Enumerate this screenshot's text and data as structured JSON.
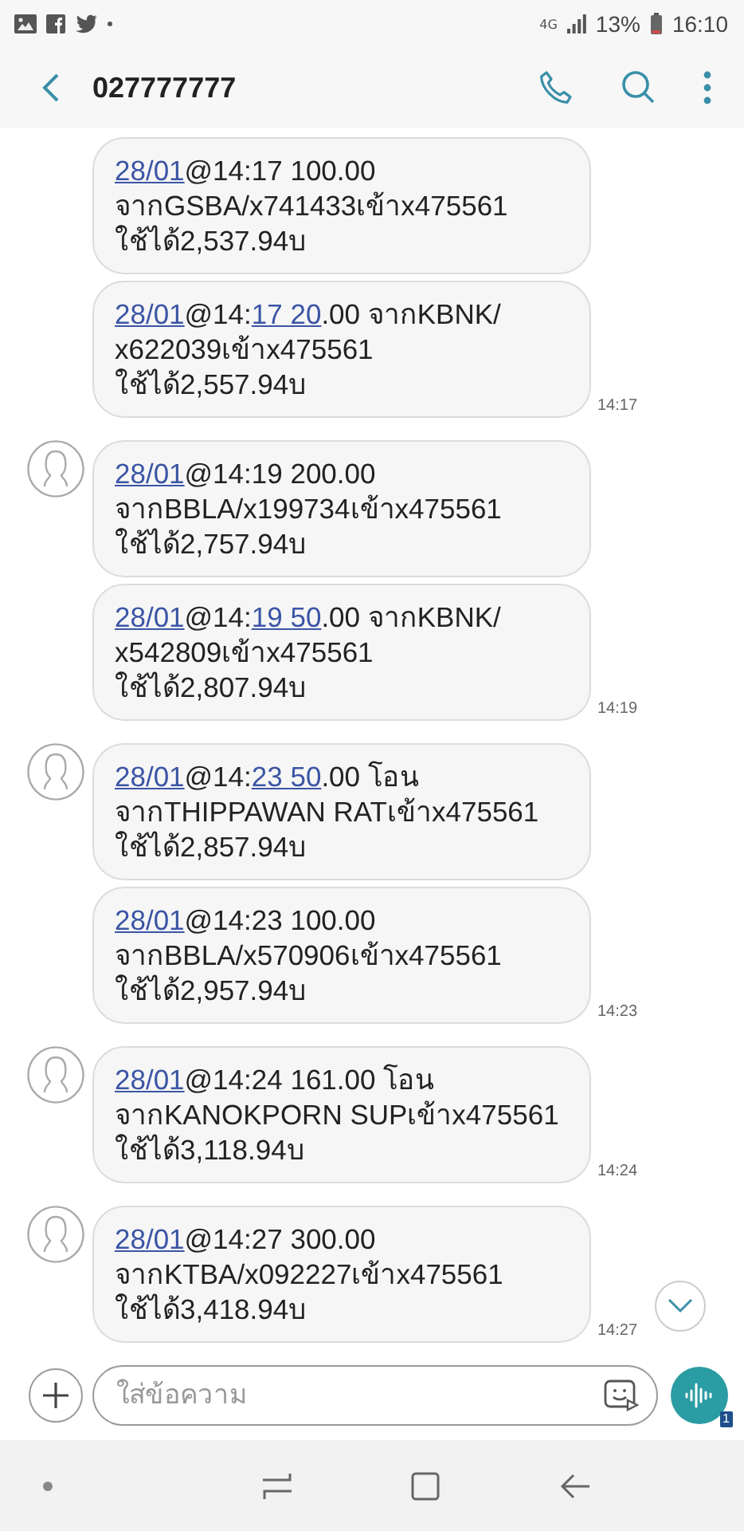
{
  "status_bar": {
    "network": "4G",
    "battery": "13%",
    "time": "16:10"
  },
  "header": {
    "title": "027777777"
  },
  "messages": [
    {
      "avatar": false,
      "lines": [
        [
          {
            "text": "28/01",
            "link": true
          },
          {
            "text": "@14:17 100.00",
            "link": false
          }
        ],
        [
          {
            "text": "จากGSBA/x741433เข้าx475561",
            "link": false
          }
        ],
        [
          {
            "text": "ใช้ได้2,537.94บ",
            "link": false
          }
        ]
      ]
    },
    {
      "avatar": false,
      "time": "14:17",
      "lines": [
        [
          {
            "text": "28/01",
            "link": true
          },
          {
            "text": "@14:",
            "link": false
          },
          {
            "text": "17 20",
            "link": true
          },
          {
            "text": ".00 จากKBNK/",
            "link": false
          }
        ],
        [
          {
            "text": "x622039เข้าx475561",
            "link": false
          }
        ],
        [
          {
            "text": "ใช้ได้2,557.94บ",
            "link": false
          }
        ]
      ]
    },
    {
      "avatar": true,
      "lines": [
        [
          {
            "text": "28/01",
            "link": true
          },
          {
            "text": "@14:19 200.00",
            "link": false
          }
        ],
        [
          {
            "text": "จากBBLA/x199734เข้าx475561",
            "link": false
          }
        ],
        [
          {
            "text": "ใช้ได้2,757.94บ",
            "link": false
          }
        ]
      ]
    },
    {
      "avatar": false,
      "time": "14:19",
      "lines": [
        [
          {
            "text": "28/01",
            "link": true
          },
          {
            "text": "@14:",
            "link": false
          },
          {
            "text": "19 50",
            "link": true
          },
          {
            "text": ".00 จากKBNK/",
            "link": false
          }
        ],
        [
          {
            "text": "x542809เข้าx475561",
            "link": false
          }
        ],
        [
          {
            "text": "ใช้ได้2,807.94บ",
            "link": false
          }
        ]
      ]
    },
    {
      "avatar": true,
      "lines": [
        [
          {
            "text": "28/01",
            "link": true
          },
          {
            "text": "@14:",
            "link": false
          },
          {
            "text": "23 50",
            "link": true
          },
          {
            "text": ".00 โอน",
            "link": false
          }
        ],
        [
          {
            "text": "จากTHIPPAWAN RATเข้าx475561",
            "link": false
          }
        ],
        [
          {
            "text": "ใช้ได้2,857.94บ",
            "link": false
          }
        ]
      ]
    },
    {
      "avatar": false,
      "time": "14:23",
      "lines": [
        [
          {
            "text": "28/01",
            "link": true
          },
          {
            "text": "@14:23 100.00",
            "link": false
          }
        ],
        [
          {
            "text": "จากBBLA/x570906เข้าx475561",
            "link": false
          }
        ],
        [
          {
            "text": "ใช้ได้2,957.94บ",
            "link": false
          }
        ]
      ]
    },
    {
      "avatar": true,
      "time": "14:24",
      "lines": [
        [
          {
            "text": "28/01",
            "link": true
          },
          {
            "text": "@14:24 161.00 โอน",
            "link": false
          }
        ],
        [
          {
            "text": "จากKANOKPORN SUPเข้าx475561",
            "link": false
          }
        ],
        [
          {
            "text": "ใช้ได้3,118.94บ",
            "link": false
          }
        ]
      ]
    },
    {
      "avatar": true,
      "time": "14:27",
      "lines": [
        [
          {
            "text": "28/01",
            "link": true
          },
          {
            "text": "@14:27 300.00",
            "link": false
          }
        ],
        [
          {
            "text": "จากKTBA/x092227เข้าx475561",
            "link": false
          }
        ],
        [
          {
            "text": "ใช้ได้3,418.94บ",
            "link": false
          }
        ]
      ]
    }
  ],
  "composer": {
    "placeholder": "ใส่ข้อความ",
    "sim_badge": "1"
  }
}
